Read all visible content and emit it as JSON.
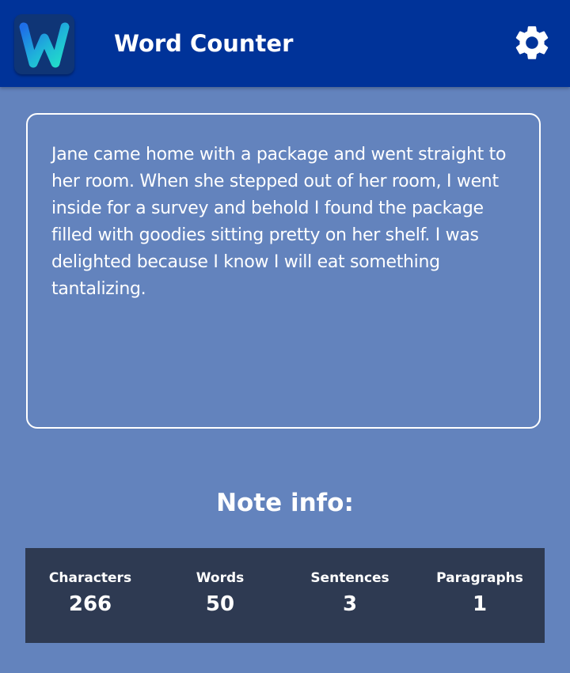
{
  "app_bar": {
    "title": "Word Counter",
    "logo_letter": "W",
    "logo_icon": "w-logo-icon",
    "settings_icon": "gear-icon",
    "background_color": "#003399"
  },
  "note": {
    "text": "Jane came home with a package and went straight to her room. When she stepped out of her room, I went inside for a survey and behold I found the package filled with goodies sitting pretty on her shelf. I was delighted because I know I will eat something tantalizing."
  },
  "info": {
    "heading": "Note info:",
    "stats": [
      {
        "label": "Characters",
        "value": "266"
      },
      {
        "label": "Words",
        "value": "50"
      },
      {
        "label": "Sentences",
        "value": "3"
      },
      {
        "label": "Paragraphs",
        "value": "1"
      }
    ]
  },
  "colors": {
    "page_background": "#6383bd",
    "stats_background": "#2e3a52",
    "logo_gradient_start": "#1e6fe8",
    "logo_gradient_end": "#22e0c8"
  }
}
